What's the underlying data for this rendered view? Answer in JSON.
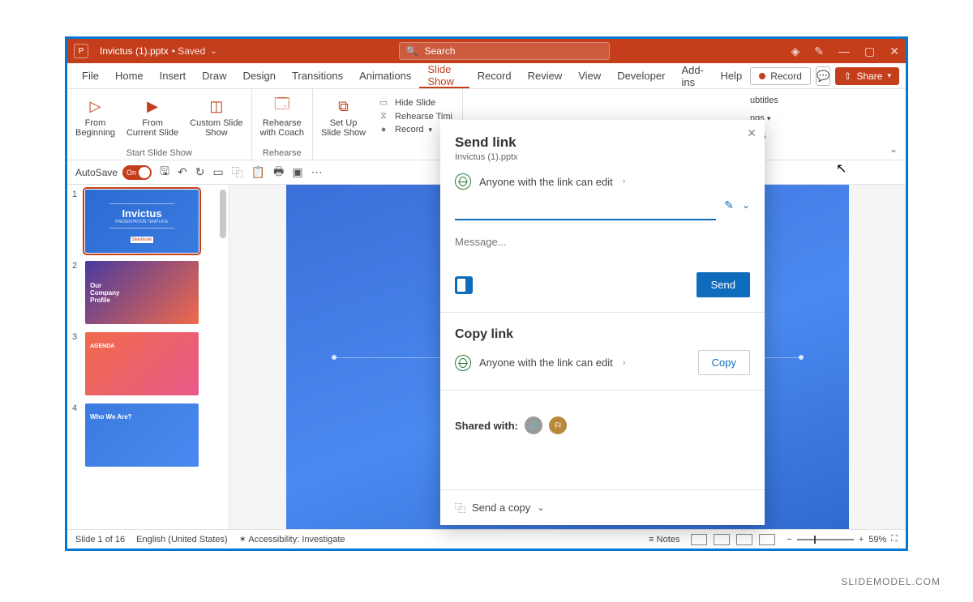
{
  "titlebar": {
    "filename": "Invictus (1).pptx",
    "saved_status": "• Saved",
    "search_placeholder": "Search"
  },
  "menubar": {
    "tabs": [
      "File",
      "Home",
      "Insert",
      "Draw",
      "Design",
      "Transitions",
      "Animations",
      "Slide Show",
      "Record",
      "Review",
      "View",
      "Developer",
      "Add-ins",
      "Help"
    ],
    "active": "Slide Show",
    "record": "Record",
    "share": "Share"
  },
  "ribbon": {
    "from_beginning": "From\nBeginning",
    "from_current": "From\nCurrent Slide",
    "custom": "Custom Slide\nShow",
    "group1": "Start Slide Show",
    "rehearse_coach": "Rehearse\nwith Coach",
    "setup": "Set Up\nSlide Show",
    "group2": "Rehearse",
    "hide_slide": "Hide Slide",
    "rehearse_timings": "Rehearse Timi",
    "record_drop": "Record",
    "subtitles1": "ubtitles",
    "settings": "ngs",
    "subtitles2": "itles"
  },
  "qat": {
    "autosave": "AutoSave",
    "toggle": "On"
  },
  "thumbs": {
    "items": [
      {
        "num": "1",
        "title": "Invictus",
        "sub": "PRESENTATION TEMPLATE",
        "logo": "SlideModel"
      },
      {
        "num": "2",
        "title": "Our\nCompany\nProfile"
      },
      {
        "num": "3",
        "title": "AGENDA"
      },
      {
        "num": "4",
        "title": "Who We Are?"
      }
    ]
  },
  "share": {
    "title": "Send link",
    "filename": "Invictus (1).pptx",
    "permission": "Anyone with the link can edit",
    "message_placeholder": "Message...",
    "send": "Send",
    "copy_title": "Copy link",
    "copy_btn": "Copy",
    "shared_with": "Shared with:",
    "avatar2": "FI",
    "send_a_copy": "Send a copy"
  },
  "status": {
    "slide": "Slide 1 of 16",
    "lang": "English (United States)",
    "access": "Accessibility: Investigate",
    "notes": "Notes",
    "zoom": "59%"
  },
  "watermark": "SLIDEMODEL.COM"
}
